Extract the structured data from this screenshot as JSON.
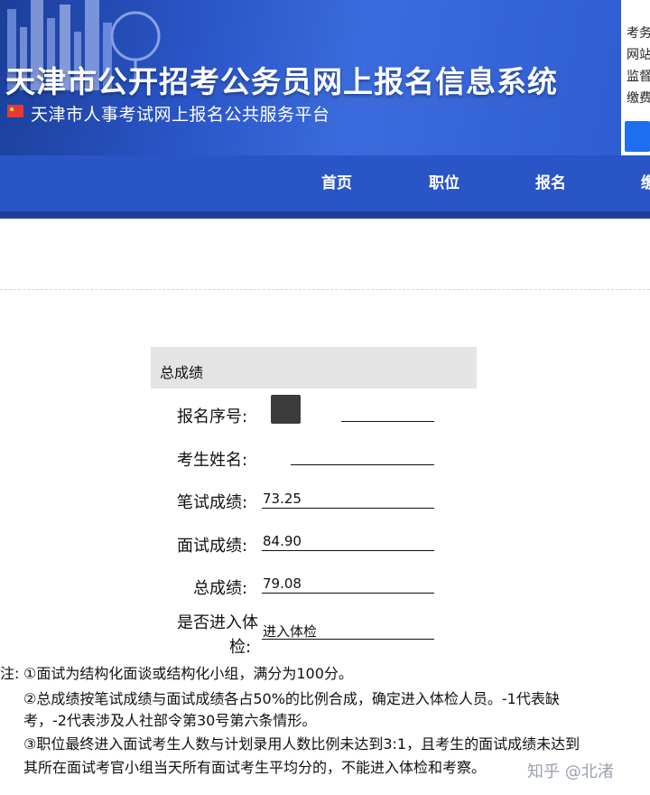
{
  "header": {
    "title": "天津市公开招考公务员网上报名信息系统",
    "subtitle": "天津市人事考试网上报名公共服务平台",
    "side_links": [
      "考务",
      "网站",
      "监督",
      "缴费"
    ]
  },
  "nav": {
    "items": [
      "首页",
      "职位",
      "报名",
      "缴"
    ]
  },
  "score": {
    "section_title": "总成绩",
    "rows": [
      {
        "label": "报名序号:",
        "value": ""
      },
      {
        "label": "考生姓名:",
        "value": ""
      },
      {
        "label": "笔试成绩:",
        "value": "73.25"
      },
      {
        "label": "面试成绩:",
        "value": "84.90"
      },
      {
        "label": "总成绩:",
        "value": "79.08"
      },
      {
        "label_line1": "是否进入体",
        "label_line2": "检:",
        "value": "进入体检"
      }
    ]
  },
  "notes": {
    "prefix": "注:",
    "line1": "①面试为结构化面谈或结构化小组，满分为100分。",
    "line2a": "②总成绩按笔试成绩与面试成绩各占50%的比例合成，确定进入体检人员。-1代表缺",
    "line2b": "考，-2代表涉及人社部令第30号第六条情形。",
    "line3a": "③职位最终进入面试考生人数与计划录用人数比例未达到3:1，且考生的面试成绩未达到",
    "line3b": "其所在面试考官小组当天所有面试考生平均分的，不能进入体检和考察。"
  },
  "watermark": "知乎 @北渚",
  "colors": {
    "banner": "#2a55c7",
    "nav": "#2a55c7",
    "side_button": "#1e6ff0"
  }
}
